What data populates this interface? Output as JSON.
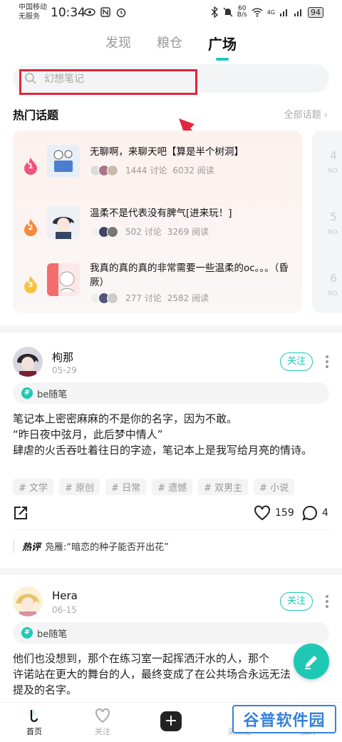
{
  "status_bar": {
    "carrier1": "中国移动",
    "carrier2": "无服务",
    "time": "10:34",
    "network_speed_top": "60",
    "network_speed_unit": "B/s",
    "network_type": "4G",
    "battery": "94"
  },
  "tabs": [
    {
      "label": "发现",
      "active": false
    },
    {
      "label": "粮仓",
      "active": false
    },
    {
      "label": "广场",
      "active": true
    }
  ],
  "search": {
    "placeholder": "幻想笔记"
  },
  "hot_topics": {
    "title": "热门话题",
    "all_link": "全部话题 ›",
    "items": [
      {
        "rank": "1",
        "name": "无聊啊，来聊天吧【算是半个树洞】",
        "discussions": "1444 讨论",
        "reads": "6032 阅读",
        "rank_color": "#f0547b"
      },
      {
        "rank": "2",
        "name": "温柔不是代表没有脾气[进来玩！]",
        "discussions": "502 讨论",
        "reads": "3269 阅读",
        "rank_color": "#f58a3c"
      },
      {
        "rank": "3",
        "name": "我真的真的真的非常需要一些温柔的oc。。。（昏厥）",
        "discussions": "277 讨论",
        "reads": "2582 阅读",
        "rank_color": "#f7c23f"
      }
    ],
    "next_column": [
      {
        "num": "4",
        "label": "NO."
      },
      {
        "num": "5",
        "label": "NO."
      },
      {
        "num": "6",
        "label": "NO."
      }
    ]
  },
  "posts": [
    {
      "author": "枸那",
      "date": "05-29",
      "follow": "关注",
      "circle": "be随笔",
      "text_lines": [
        "笔记本上密密麻麻的不是你的名字，因为不敢。",
        "“昨日夜中弦月，此后梦中情人”",
        "肆虐的火舌吞吐着往日的字迹，笔记本上是我写给月亮的情诗。"
      ],
      "tags": [
        "# 文学",
        "# 原创",
        "# 日常",
        "# 遗憾",
        "# 双男主",
        "# 小说"
      ],
      "likes": "159",
      "comments": "4",
      "hot_comment_label": "热评",
      "hot_comment": "凫雁:“暗恋的种子能否开出花”"
    },
    {
      "author": "Hera",
      "date": "06-15",
      "follow": "关注",
      "circle": "be随笔",
      "text_lines": [
        "他们也没想到，那个在练习室一起挥洒汗水的人，那个",
        "许诺站在更大的舞台的人，最终变成了在公共场合永远无法",
        "提及的名字。"
      ]
    }
  ],
  "bottom_nav": [
    {
      "label": "首页",
      "active": true
    },
    {
      "label": "关注",
      "active": false
    },
    {
      "label": "",
      "active": false
    },
    {
      "label": "买周边",
      "active": false
    },
    {
      "label": "我的",
      "active": false
    }
  ],
  "watermark": "谷普软件园",
  "colors": {
    "accent": "#1fc8b4",
    "annotation": "#e0263c"
  }
}
